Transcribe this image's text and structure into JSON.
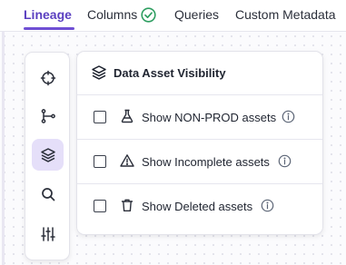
{
  "tabs": [
    {
      "label": "Lineage",
      "active": true
    },
    {
      "label": "Columns",
      "status_icon": "check-circle-icon"
    },
    {
      "label": "Queries"
    },
    {
      "label": "Custom Metadata"
    }
  ],
  "colors": {
    "accent": "#6f4fd4",
    "active_tool_bg": "#e5dff9",
    "check_green": "#2e9e60"
  },
  "toolbar": {
    "tools": [
      {
        "icon": "crosshair-icon"
      },
      {
        "icon": "lineage-tree-icon"
      },
      {
        "icon": "layers-icon",
        "active": true
      },
      {
        "icon": "search-icon"
      },
      {
        "icon": "sliders-icon"
      }
    ]
  },
  "visibility_panel": {
    "title": "Data Asset Visibility",
    "options": [
      {
        "label": "Show NON-PROD assets",
        "icon": "flask-icon",
        "checked": false
      },
      {
        "label": "Show Incomplete assets",
        "icon": "warning-icon",
        "checked": false
      },
      {
        "label": "Show Deleted assets",
        "icon": "trash-icon",
        "checked": false
      }
    ]
  }
}
